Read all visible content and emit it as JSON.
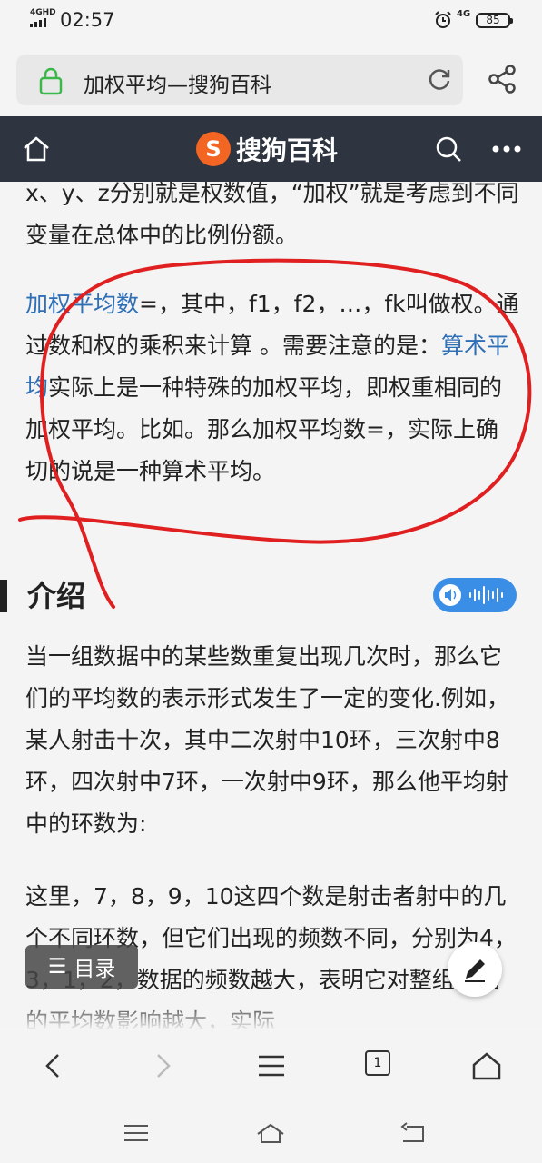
{
  "status_bar": {
    "network_label": "4GHD",
    "time": "02:57",
    "network_type": "4G",
    "battery": "85"
  },
  "browser": {
    "page_title": "加权平均—搜狗百科"
  },
  "header": {
    "brand_logo_letter": "S",
    "brand_name": "搜狗百科"
  },
  "article": {
    "para1": "x、y、z分别就是权数值，“加权”就是考虑到不同变量在总体中的比例份额。",
    "para2": {
      "link1": "加权平均数",
      "text1": "=，其中，f1，f2，…，fk叫做权。通过数和权的乘积来计算 。需要注意的是：",
      "link2": "算术平均",
      "text2": "实际上是一种特殊的加权平均，即权重相同的加权平均。比如。那么加权平均数=，实际上确切的说是一种算术平均。"
    },
    "section_title": "介绍",
    "para3": "当一组数据中的某些数重复出现几次时，那么它们的平均数的表示形式发生了一定的变化.例如，某人射击十次，其中二次射中10环，三次射中8环，四次射中7环，一次射中9环，那么他平均射中的环数为:",
    "para4": "这里，7，8，9，10这四个数是射击者射中的几个不同环数，但它们出现的频数不同，分别为4，3，1，2，数据的频数越大，表明它对整组数据的平均数影响越大，实际"
  },
  "toc_button": {
    "icon": "☰",
    "label": "目录"
  },
  "toolbar": {
    "tab_count": "1"
  },
  "icons": [
    "signal-icon",
    "alarm-icon",
    "battery-icon",
    "lock-icon",
    "reload-icon",
    "share-icon",
    "home-icon",
    "search-icon",
    "more-icon",
    "voice-icon",
    "edit-icon",
    "back-icon",
    "forward-icon",
    "menu-icon",
    "tabs-icon",
    "browser-home-icon",
    "recent-apps-icon",
    "system-home-icon",
    "system-back-icon"
  ],
  "colors": {
    "header_bg": "#2e3440",
    "brand_orange": "#f26522",
    "link_blue": "#2f6fb6",
    "voice_blue": "#3a8ee6",
    "annotation_red": "#e02020"
  }
}
